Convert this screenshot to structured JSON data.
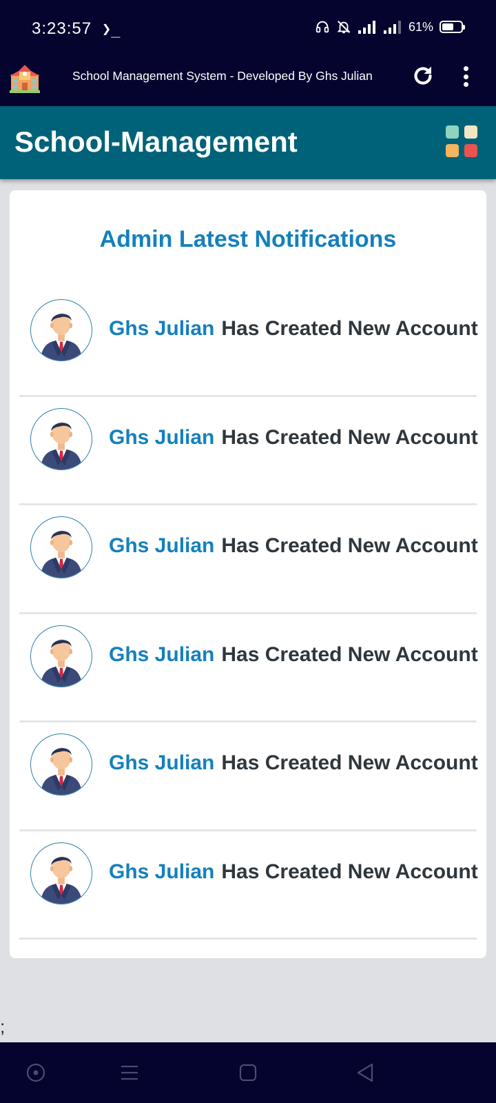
{
  "status_bar": {
    "time": "3:23:57",
    "terminal_glyph": "❯_",
    "battery_percent": "61%",
    "battery_level": 0.61
  },
  "app_bar": {
    "title": "School Management System - Developed By Ghs Julian"
  },
  "header": {
    "title": "School-Management",
    "grid_colors": [
      "#8ed4be",
      "#f3e6c2",
      "#f5b45e",
      "#ea5450"
    ]
  },
  "card": {
    "title": "Admin Latest Notifications",
    "notifications": [
      {
        "name": "Ghs Julian",
        "message": "Has Created New Account"
      },
      {
        "name": "Ghs Julian",
        "message": "Has Created New Account"
      },
      {
        "name": "Ghs Julian",
        "message": "Has Created New Account"
      },
      {
        "name": "Ghs Julian",
        "message": "Has Created New Account"
      },
      {
        "name": "Ghs Julian",
        "message": "Has Created New Account"
      },
      {
        "name": "Ghs Julian",
        "message": "Has Created New Account"
      }
    ]
  },
  "footer": {
    "stray_text": ";"
  },
  "colors": {
    "status_bar_bg": "#04042e",
    "header_bg": "#006278",
    "accent_blue": "#1480bd",
    "text_dark": "#2f373d"
  },
  "icons": {
    "app_logo": "school-building-icon",
    "refresh": "refresh-icon",
    "menu": "more-vert-icon",
    "grid": "apps-grid-icon",
    "avatar": "user-avatar-icon"
  }
}
